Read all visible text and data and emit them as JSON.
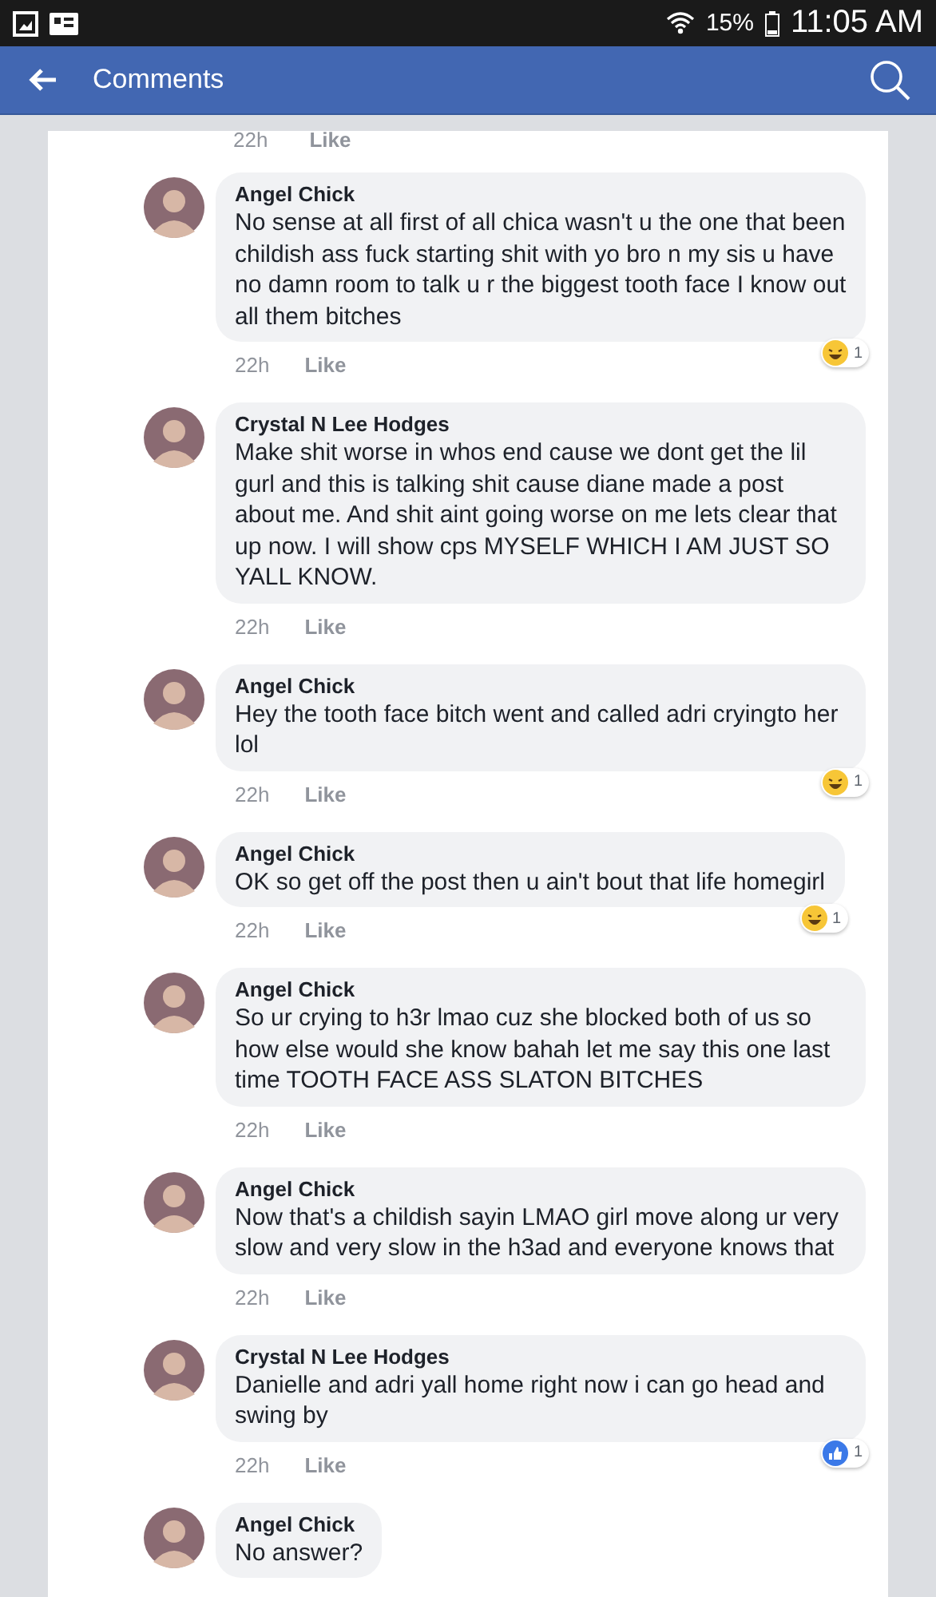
{
  "status_bar": {
    "battery": "15%",
    "time": "11:05 AM"
  },
  "header": {
    "title": "Comments"
  },
  "top_meta": {
    "time": "22h",
    "like": "Like"
  },
  "comments": [
    {
      "author": "Angel Chick",
      "text": "No sense  at all first of all chica  wasn't u the one that been childish ass  fuck  starting shit with yo  bro  n my sis  u have no damn room to talk u r the biggest tooth face I know out all them bitches",
      "time": "22h",
      "like": "Like",
      "reaction": {
        "kind": "haha",
        "count": "1"
      }
    },
    {
      "author": "Crystal N Lee Hodges",
      "text": "Make shit worse in whos end cause we dont get the lil gurl and this is talking shit cause diane made a post about me. And shit aint going worse on me lets clear that up now. I will show cps MYSELF WHICH I AM JUST SO YALL KNOW.",
      "time": "22h",
      "like": "Like"
    },
    {
      "author": "Angel Chick",
      "text": "Hey the tooth face bitch  went and called adri  cryingto her lol",
      "time": "22h",
      "like": "Like",
      "reaction": {
        "kind": "haha",
        "count": "1"
      }
    },
    {
      "author": "Angel Chick",
      "text": "OK so get off the post then u ain't bout that life homegirl",
      "time": "22h",
      "like": "Like",
      "reaction": {
        "kind": "haha",
        "count": "1"
      }
    },
    {
      "author": "Angel Chick",
      "text": "So ur crying to h3r lmao  cuz  she blocked both of us so how else would she know bahah  let me say this one last time TOOTH FACE ASS  SLATON BITCHES",
      "time": "22h",
      "like": "Like"
    },
    {
      "author": "Angel Chick",
      "text": "Now that's a childish sayin  LMAO  girl move along ur very slow and very slow in the h3ad and everyone knows  that",
      "time": "22h",
      "like": "Like"
    },
    {
      "author": "Crystal N Lee Hodges",
      "text": "Danielle and adri yall home right now i can go head and swing by",
      "time": "22h",
      "like": "Like",
      "reaction": {
        "kind": "like",
        "count": "1"
      }
    },
    {
      "author": "Angel Chick",
      "text": "No answer?"
    }
  ]
}
